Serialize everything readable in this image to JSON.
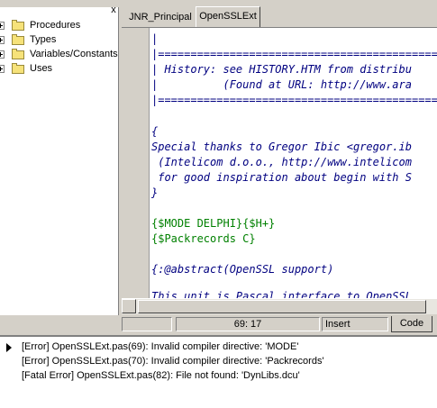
{
  "tree": {
    "close_glyph": "x",
    "items": [
      {
        "label": "Procedures"
      },
      {
        "label": "Types"
      },
      {
        "label": "Variables/Constants"
      },
      {
        "label": "Uses"
      }
    ]
  },
  "tabs": [
    {
      "label": "JNR_Principal",
      "active": false
    },
    {
      "label": "OpenSSLExt",
      "active": true
    }
  ],
  "editor": {
    "lines": [
      "|",
      "|================================================",
      "| History: see HISTORY.HTM from distribu",
      "|          (Found at URL: http://www.ara",
      "|================================================",
      "",
      "{",
      "Special thanks to Gregor Ibic <gregor.ib",
      " (Intelicom d.o.o., http://www.intelicom",
      " for good inspiration about begin with S",
      "}",
      "",
      "{$MODE DELPHI}{$H+}",
      "{$Packrecords C}",
      "",
      "{:@abstract(OpenSSL support)",
      "",
      "This unit is Pascal interface to OpenSSL"
    ]
  },
  "status": {
    "cursor_pos": "69:  17",
    "mode": "Insert",
    "code_tab": "Code"
  },
  "messages": [
    "[Error] OpenSSLExt.pas(69): Invalid compiler directive: 'MODE'",
    "[Error] OpenSSLExt.pas(70): Invalid compiler directive: 'Packrecords'",
    "[Fatal Error] OpenSSLExt.pas(82): File not found: 'DynLibs.dcu'"
  ]
}
